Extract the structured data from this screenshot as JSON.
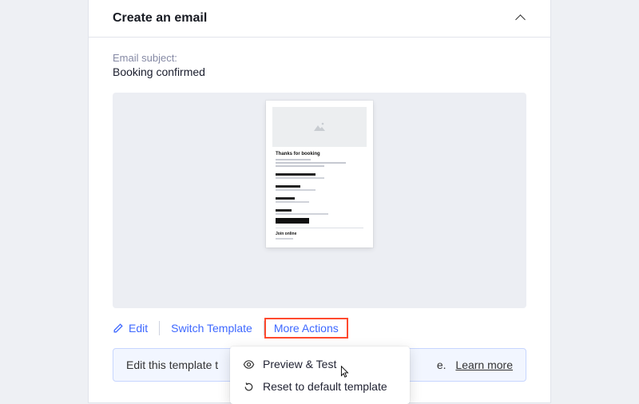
{
  "header": {
    "title": "Create an email"
  },
  "subject": {
    "label": "Email subject:",
    "value": "Booking confirmed"
  },
  "thumb": {
    "heading": "Thanks for booking"
  },
  "actions": {
    "edit": "Edit",
    "switch": "Switch Template",
    "more": "More Actions"
  },
  "dropdown": {
    "preview": "Preview & Test",
    "reset": "Reset to default template"
  },
  "banner": {
    "text": "Edit this template t",
    "truncated_tail": "e.",
    "learn": "Learn more"
  }
}
